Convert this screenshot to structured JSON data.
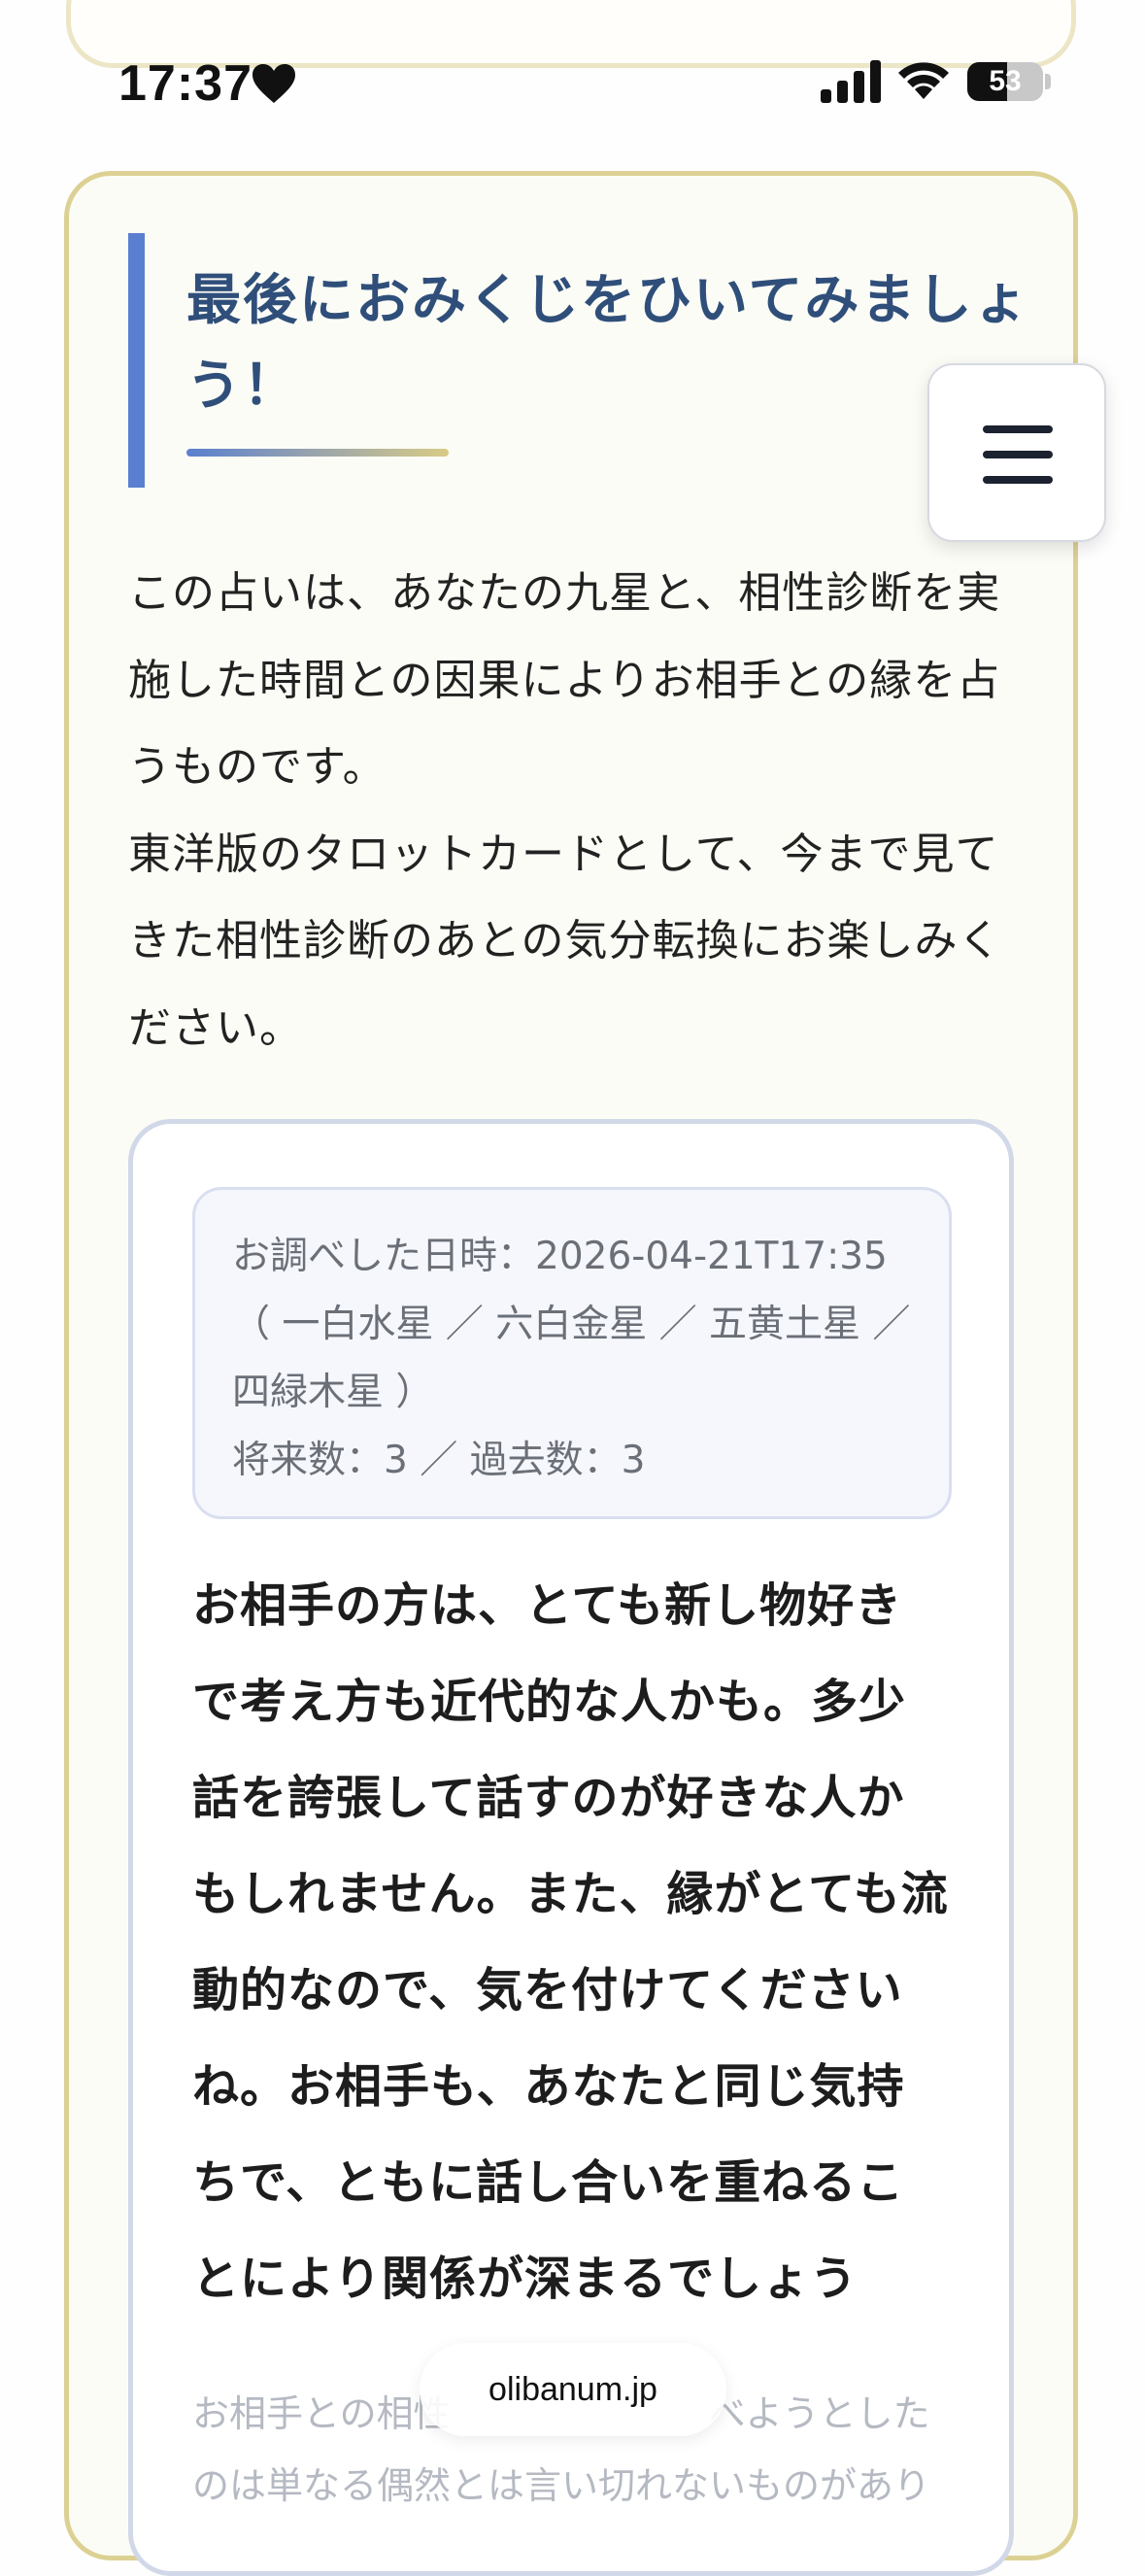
{
  "status_bar": {
    "time": "17:37",
    "battery_level": "53",
    "battery_fraction": 0.53
  },
  "section": {
    "heading": "最後におみくじをひいてみましょう！",
    "intro": "この占いは、あなたの九星と、相性診断を実施した時間との因果によりお相手との縁を占うものです。\n東洋版のタロットカードとして、今まで見てきた相性診断のあとの気分転換にお楽しみください。"
  },
  "result": {
    "info": {
      "datetime_line": "お調べした日時：2026-04-21T17:35",
      "stars_line_1": "（ 一白水星 ／ 六白金星 ／ 五黄土星 ／",
      "stars_line_2": "四緑木星 ）",
      "numbers_line": "将来数：3 ／ 過去数：3"
    },
    "fortune": "お相手の方は、とても新し物好きで考え方も近代的な人かも。多少話を誇張して話すのが好きな人かもしれません。また、縁がとても流動的なので、気を付けてくださいね。お相手も、あなたと同じ気持ちで、ともに話し合いを重ねることにより関係が深まるでしょう",
    "faded_note_line_1": "お相手との相性　　　　　　　べようとした",
    "faded_note_line_2": "のは単なる偶然とは言い切れないものがあり"
  },
  "browser": {
    "url": "olibanum.jp"
  },
  "colors": {
    "heading": "#2f4f7a",
    "accent_blue": "#5b7fd0",
    "card_border_gold": "#dcd193",
    "result_border": "#d1d8e8"
  },
  "icons": [
    "heart-icon",
    "cellular-signal-icon",
    "wifi-icon",
    "battery-icon",
    "hamburger-menu-icon"
  ]
}
